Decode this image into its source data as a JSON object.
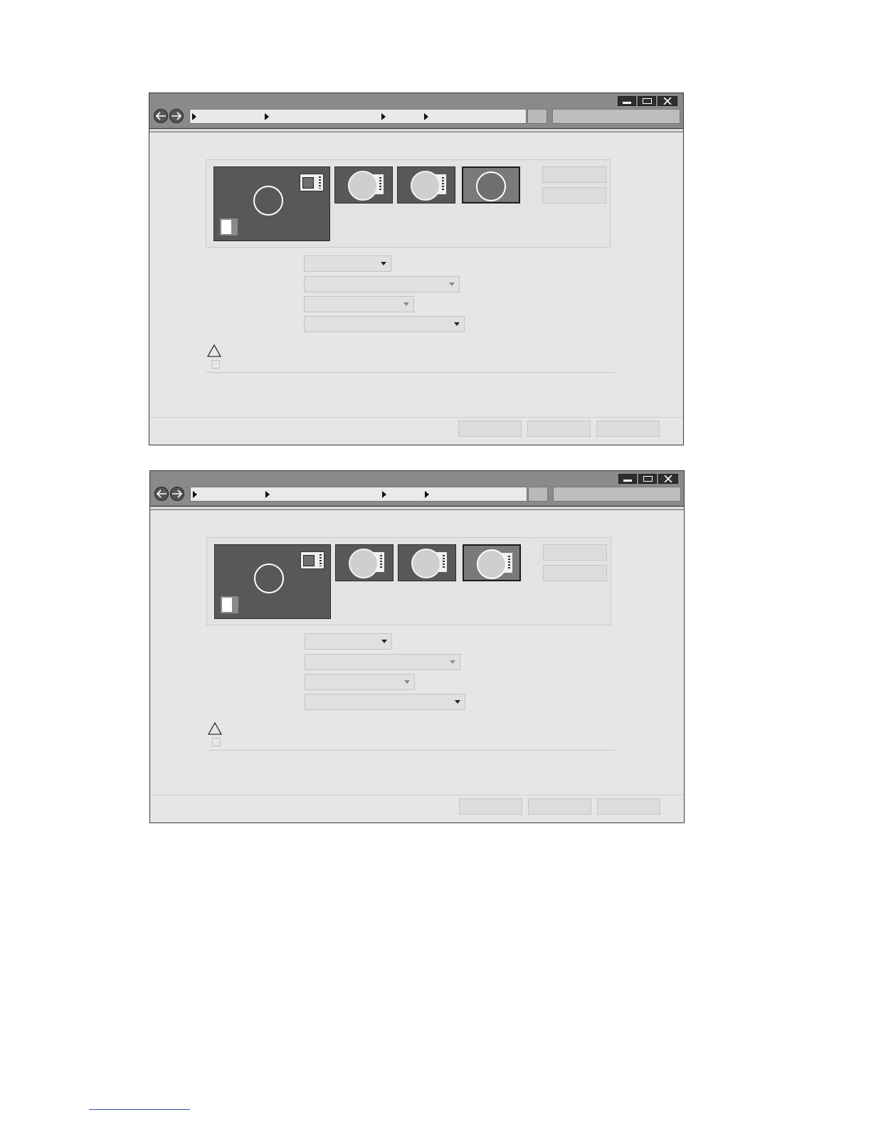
{
  "windows": [
    {
      "id": "window-top",
      "selected_thumbnail": 3
    },
    {
      "id": "window-bottom",
      "selected_thumbnail": 3
    }
  ],
  "titlebar": {
    "buttons": [
      "minimize-icon",
      "maximize-icon",
      "close-icon"
    ]
  },
  "navigation": {
    "icons": [
      "back-arrow-icon",
      "forward-arrow-icon"
    ],
    "breadcrumb_separators": 4
  },
  "colors": {
    "titlebar": "#8a8a8b",
    "window_bg": "#e6e6e7",
    "preview_bg": "#585859",
    "selected_thumbnail_bg": "#7a7a7b",
    "footnote_rule": "#2b4ea0"
  },
  "icons": [
    "warning-triangle-icon",
    "display-icon",
    "document-icon",
    "dropdown-caret-icon"
  ]
}
